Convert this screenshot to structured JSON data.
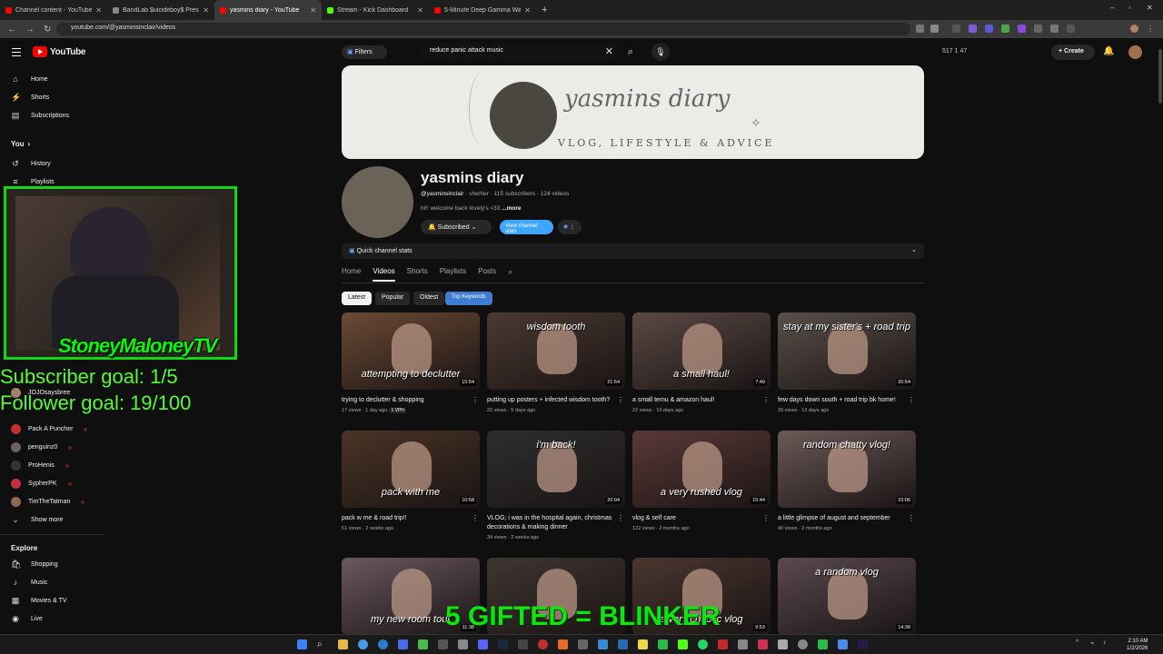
{
  "browser": {
    "tabs": [
      {
        "label": "Channel content - YouTube Stu",
        "color": "#ff0000"
      },
      {
        "label": "BandLab $uicideboy$ Preset",
        "color": "#888888"
      },
      {
        "label": "yasmins diary - YouTube",
        "color": "#ff0000"
      },
      {
        "label": "Stream - Kick Dashboard",
        "color": "#53fc18"
      },
      {
        "label": "5-Minute Deep Gamma Wave",
        "color": "#ff0000"
      }
    ],
    "url": "youtube.com/@yasminsinclair/videos"
  },
  "yt": {
    "logo_text": "YouTube",
    "filters_label": "Filters",
    "search_value": "reduce panic attack music",
    "top_stats": "517 1 47",
    "create_label": "Create"
  },
  "sidebar": {
    "home": "Home",
    "shorts": "Shorts",
    "subscriptions": "Subscriptions",
    "you": "You",
    "history": "History",
    "playlists": "Playlists",
    "subs": [
      "JOJOsaysbree",
      "Pack A Puncher",
      "penguinz0",
      "ProHenis",
      "SypherPK",
      "TimTheTatman"
    ],
    "show_more": "Show more",
    "explore": "Explore",
    "explore_items": [
      "Shopping",
      "Music",
      "Movies & TV",
      "Live"
    ]
  },
  "overlay": {
    "brand": "StoneyMaloneyTV",
    "sub_goal": "Subscriber goal: 1/5",
    "follower_goal": "Follower goal: 19/100",
    "gifted": "5 GIFTED = BLINKER"
  },
  "channel": {
    "banner_script": "yasmins diary",
    "banner_tag": "VLOG, LIFESTYLE & ADVICE",
    "name": "yasmins diary",
    "handle": "@yasminsinclair",
    "meta": "· she/her · 115 subscribers · 124 videos",
    "desc": "hi!! welcome back lovely's <33",
    "more": "...more",
    "subscribed_label": "Subscribed",
    "stats_btn": "View channel stats",
    "quick_stats": "Quick channel stats",
    "tabs": [
      "Home",
      "Videos",
      "Shorts",
      "Playlists",
      "Posts"
    ],
    "chips": [
      "Latest",
      "Popular",
      "Oldest",
      "Top Keywords"
    ]
  },
  "videos": [
    {
      "title": "trying to declutter & shopping",
      "meta": "17 views · 1 day ago",
      "badge": "1 VPH",
      "dur": "15:54",
      "overlay": "attempting to declutter",
      "bg": "#6b4a34"
    },
    {
      "title": "putting up posters + infected wisdom tooth?",
      "meta": "22 views · 5 days ago",
      "dur": "21:54",
      "overlay": "wisdom tooth",
      "bg": "#4a3a32"
    },
    {
      "title": "a small temu & amazon haul!",
      "meta": "22 views · 10 days ago",
      "dur": "7:49",
      "overlay": "a small haul!",
      "bg": "#5a4a44"
    },
    {
      "title": "few days down south + road trip bk home!",
      "meta": "29 views · 12 days ago",
      "dur": "20:54",
      "overlay": "stay at my sister's + road trip",
      "bg": "#58504a"
    },
    {
      "title": "pack w me & road trip!!",
      "meta": "51 views · 2 weeks ago",
      "dur": "10:58",
      "overlay": "pack with me",
      "bg": "#4a3426"
    },
    {
      "title": "VLOG; i was in the hospital again, christmas decorations & making dinner",
      "meta": "34 views · 2 weeks ago",
      "dur": "20:04",
      "overlay": "i'm back!",
      "bg": "#2e2e2e"
    },
    {
      "title": "vlog & self care",
      "meta": "122 views · 2 months ago",
      "dur": "15:44",
      "overlay": "a very rushed vlog",
      "bg": "#5a3a38"
    },
    {
      "title": "a little glimpse of august and september",
      "meta": "40 views · 2 months ago",
      "dur": "23:06",
      "overlay": "random chatty vlog!",
      "bg": "#6a5a58"
    },
    {
      "title": "",
      "meta": "",
      "dur": "11:38",
      "overlay": "my new room tour",
      "bg": "#6a5860"
    },
    {
      "title": "",
      "meta": "",
      "dur": "",
      "overlay": "",
      "bg": "#3e3632"
    },
    {
      "title": "",
      "meta": "",
      "dur": "9:53",
      "overlay": "a very chaotic vlog",
      "bg": "#4a3630"
    },
    {
      "title": "",
      "meta": "",
      "dur": "14:38",
      "overlay": "a random vlog",
      "bg": "#5a4a50"
    }
  ],
  "clock": {
    "time": "2:10 AM",
    "date": "1/2/2026"
  }
}
